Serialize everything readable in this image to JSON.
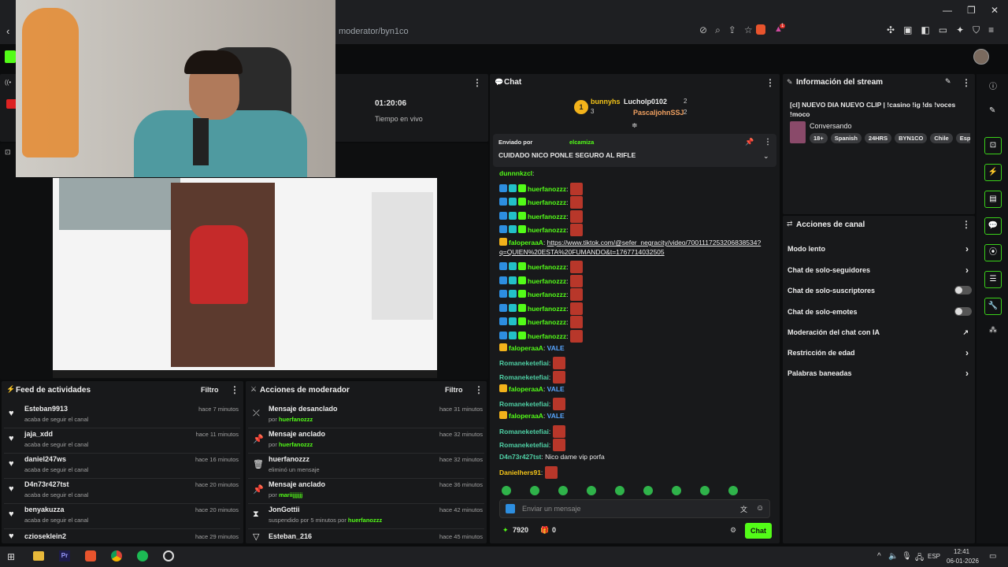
{
  "browser": {
    "url": "moderator/byn1co",
    "tab_count": "1"
  },
  "stream_info_left": {
    "duration": "01:20:06",
    "duration_label": "Tiempo en vivo"
  },
  "chat": {
    "title": "Chat",
    "top_gifters": [
      {
        "rank": "1",
        "name": "bunnyhs",
        "count": "3"
      },
      {
        "rank": "",
        "name": "Lucholp0102",
        "count": "2"
      },
      {
        "rank": "",
        "name": "PascaljohnSSJ",
        "count": "2"
      }
    ],
    "pinned": {
      "sent_by_label": "Enviado por",
      "author": "elcamiza",
      "message": "CUIDADO NICO PONLE SEGURO AL RIFLE"
    },
    "messages": [
      {
        "user": "dunnnkzcl",
        "text": ""
      },
      {
        "user": "huerfanozzz",
        "text": ""
      },
      {
        "user": "huerfanozzz",
        "text": ""
      },
      {
        "user": "huerfanozzz",
        "text": ""
      },
      {
        "user": "huerfanozzz",
        "text": ""
      },
      {
        "user": "faloperaaA",
        "text": "https://www.tiktok.com/@sefer_negracity/video/7001117253206838534?",
        "text2": "q=QUIEN%20ESTA%20FUMANDO&t=1767714032505"
      },
      {
        "user": "huerfanozzz",
        "text": ""
      },
      {
        "user": "huerfanozzz",
        "text": ""
      },
      {
        "user": "huerfanozzz",
        "text": ""
      },
      {
        "user": "huerfanozzz",
        "text": ""
      },
      {
        "user": "huerfanozzz",
        "text": ""
      },
      {
        "user": "huerfanozzz",
        "text": ""
      },
      {
        "user": "faloperaaA",
        "text": "VALE"
      },
      {
        "user": "Romaneketefiai",
        "text": ""
      },
      {
        "user": "Romaneketefiai",
        "text": ""
      },
      {
        "user": "faloperaaA",
        "text": "VALE"
      },
      {
        "user": "Romaneketefiai",
        "text": ""
      },
      {
        "user": "faloperaaA",
        "text": "VALE"
      },
      {
        "user": "Romaneketefiai",
        "text": ""
      },
      {
        "user": "Romaneketefiai",
        "text": ""
      },
      {
        "user": "D4n73r427tst",
        "text": "Nico dame vip porfa"
      },
      {
        "user": "Danielhers91",
        "text": ""
      }
    ],
    "input_placeholder": "Enviar un mensaje",
    "points": "7920",
    "gifts": "0",
    "send_label": "Chat"
  },
  "feed": {
    "title": "Feed de actividades",
    "filter_label": "Filtro",
    "items": [
      {
        "name": "Esteban9913",
        "sub": "acaba de seguir el canal",
        "time": "hace 7 minutos"
      },
      {
        "name": "jaja_xdd",
        "sub": "acaba de seguir el canal",
        "time": "hace 11 minutos"
      },
      {
        "name": "daniel247ws",
        "sub": "acaba de seguir el canal",
        "time": "hace 16 minutos"
      },
      {
        "name": "D4n73r427tst",
        "sub": "acaba de seguir el canal",
        "time": "hace 20 minutos"
      },
      {
        "name": "benyakuzza",
        "sub": "acaba de seguir el canal",
        "time": "hace 20 minutos"
      },
      {
        "name": "czioseklein2",
        "sub": "",
        "time": "hace 29 minutos"
      }
    ]
  },
  "mod": {
    "title": "Acciones de moderador",
    "filter_label": "Filtro",
    "items": [
      {
        "name": "Mensaje desanclado",
        "sub_prefix": "por",
        "sub_user": "huerfanozzz",
        "time": "hace 31 minutos",
        "icon": "unpin-icon"
      },
      {
        "name": "Mensaje anclado",
        "sub_prefix": "por",
        "sub_user": "huerfanozzz",
        "time": "hace 32 minutos",
        "icon": "pin-icon"
      },
      {
        "name": "huerfanozzz",
        "sub_prefix": "eliminó un mensaje",
        "sub_user": "",
        "time": "hace 32 minutos",
        "icon": "trash-icon"
      },
      {
        "name": "Mensaje anclado",
        "sub_prefix": "por",
        "sub_user": "mariijjjjjj",
        "time": "hace 36 minutos",
        "icon": "pin-icon"
      },
      {
        "name": "JonGottii",
        "sub_prefix": "suspendido por 5 minutos por",
        "sub_user": "huerfanozzz",
        "time": "hace 42 minutos",
        "icon": "hourglass-icon"
      },
      {
        "name": "Esteban_216",
        "sub_prefix": "",
        "sub_user": "",
        "time": "hace 45 minutos",
        "icon": "chevron-icon"
      }
    ]
  },
  "info": {
    "title": "Información del stream",
    "stream_title": "[cl] NUEVO DIA NUEVO CLIP | !casino !ig !ds !voces !moco",
    "category": "Conversando",
    "tags": [
      "18+",
      "Spanish",
      "24HRS",
      "BYN1CO",
      "Chile",
      "Espa"
    ]
  },
  "actions": {
    "title": "Acciones de canal",
    "items": [
      {
        "label": "Modo lento",
        "control": "chevron"
      },
      {
        "label": "Chat de solo-seguidores",
        "control": "chevron"
      },
      {
        "label": "Chat de solo-suscriptores",
        "control": "toggle"
      },
      {
        "label": "Chat de solo-emotes",
        "control": "toggle"
      },
      {
        "label": "Moderación del chat con IA",
        "control": "external"
      },
      {
        "label": "Restricción de edad",
        "control": "chevron"
      },
      {
        "label": "Palabras baneadas",
        "control": "chevron"
      }
    ]
  },
  "taskbar": {
    "time": "12:41",
    "date": "06-01-2026",
    "lang": "ESP"
  },
  "colors": {
    "accent": "#53fc18",
    "panel": "#18191b"
  }
}
